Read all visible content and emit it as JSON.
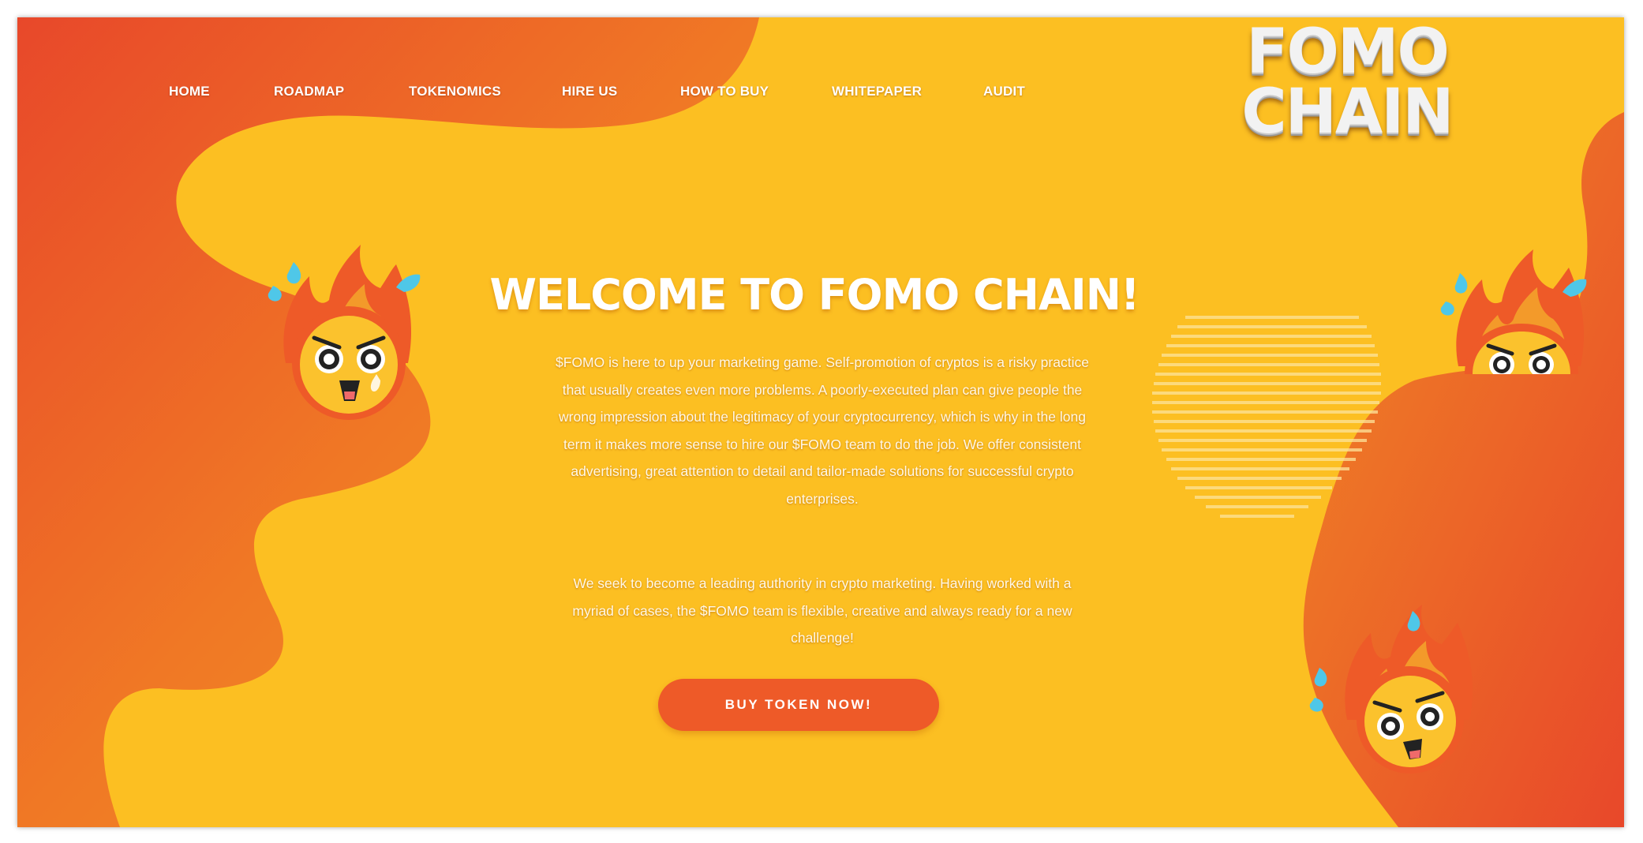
{
  "nav": {
    "items": [
      {
        "label": "HOME"
      },
      {
        "label": "ROADMAP"
      },
      {
        "label": "TOKENOMICS"
      },
      {
        "label": "HIRE US"
      },
      {
        "label": "HOW TO BUY"
      },
      {
        "label": "WHITEPAPER"
      },
      {
        "label": "AUDIT"
      }
    ]
  },
  "logo": {
    "line1": "FOMO",
    "line2": "CHAIN"
  },
  "hero": {
    "title": "WELCOME TO FOMO CHAIN!",
    "paragraph1": "$FOMO is here to up your marketing game. Self-promotion of cryptos is a risky practice that usually creates even more problems. A poorly-executed plan can give people the wrong impression about the legitimacy of your cryptocurrency, which is why in the long term it makes more sense to hire our $FOMO team to do the job. We offer consistent advertising, great attention to detail and tailor-made solutions for successful crypto enterprises.",
    "paragraph2": "We seek to become a leading authority in crypto marketing. Having worked with a myriad of cases, the $FOMO team is flexible, creative and always ready for a new challenge!",
    "cta_label": "BUY TOKEN NOW!"
  },
  "colors": {
    "background": "#fcbf22",
    "orange_dark": "#e8482a",
    "orange_mid": "#f07825",
    "button": "#ee5a28",
    "mascot_face": "#fbc22d",
    "sweat_drop": "#4fc7e8"
  },
  "icons": [
    "flame-mascot-icon",
    "sweat-drop-icon"
  ]
}
